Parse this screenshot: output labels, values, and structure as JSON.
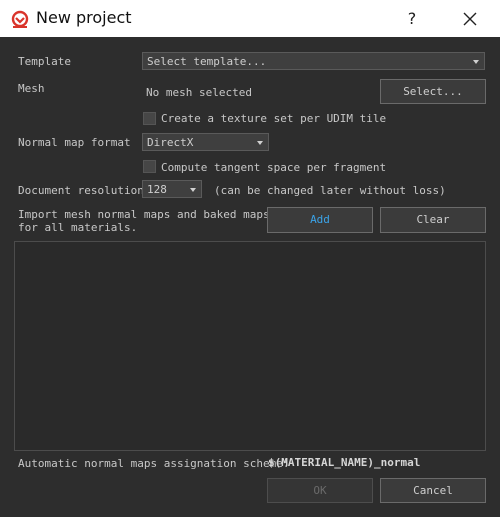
{
  "window": {
    "title": "New project",
    "help_label": "?"
  },
  "template": {
    "label": "Template",
    "value": "Select template..."
  },
  "mesh": {
    "label": "Mesh",
    "value": "No mesh selected",
    "select_button": "Select..."
  },
  "udim": {
    "label": "Create a texture set per UDIM tile",
    "checked": false
  },
  "normal_map": {
    "label": "Normal map format",
    "value": "DirectX"
  },
  "tangent": {
    "label": "Compute tangent space per fragment",
    "checked": false
  },
  "resolution": {
    "label": "Document resolution",
    "value": "128",
    "note": "(can be changed later without loss)"
  },
  "import": {
    "label_line1": "Import mesh normal maps and baked maps",
    "label_line2": "for all materials.",
    "add_button": "Add",
    "clear_button": "Clear"
  },
  "scheme": {
    "label": "Automatic normal maps assignation scheme:",
    "value": "$(MATERIAL_NAME)_normal"
  },
  "footer": {
    "ok_button": "OK",
    "cancel_button": "Cancel"
  },
  "colors": {
    "background": "#2d2d2d",
    "accent": "#3ba3e8",
    "brand": "#d9342b"
  }
}
